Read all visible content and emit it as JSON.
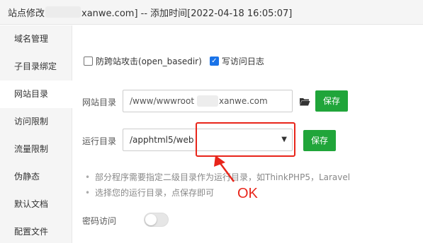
{
  "titlebar": {
    "prefix": "站点修改",
    "suffix": "xanwe.com] -- 添加时间[2022-04-18 16:05:07]"
  },
  "sidebar": {
    "items": [
      {
        "label": "域名管理",
        "active": false
      },
      {
        "label": "子目录绑定",
        "active": false
      },
      {
        "label": "网站目录",
        "active": true
      },
      {
        "label": "访问限制",
        "active": false
      },
      {
        "label": "流量限制",
        "active": false
      },
      {
        "label": "伪静态",
        "active": false
      },
      {
        "label": "默认文档",
        "active": false
      },
      {
        "label": "配置文件",
        "active": false
      }
    ]
  },
  "options": {
    "open_basedir_label": "防跨站攻击(open_basedir)",
    "open_basedir_checked": false,
    "access_log_label": "写访问日志",
    "access_log_checked": true
  },
  "site_dir": {
    "label": "网站目录",
    "value_prefix": "/www/wwwroot",
    "value_suffix": "xanwe.com",
    "save_label": "保存",
    "folder_icon": "folder-icon"
  },
  "run_dir": {
    "label": "运行目录",
    "selected": "/apphtml5/web",
    "save_label": "保存"
  },
  "tips": [
    "部分程序需要指定二级目录作为运行目录，如ThinkPHP5，Laravel",
    "选择您的运行目录，点保存即可"
  ],
  "password_access": {
    "label": "密码访问",
    "enabled": false
  },
  "annotation": {
    "text": "OK",
    "color": "#e8251a"
  },
  "colors": {
    "save_button": "#20a53a",
    "checkbox_checked": "#1a73e8"
  }
}
